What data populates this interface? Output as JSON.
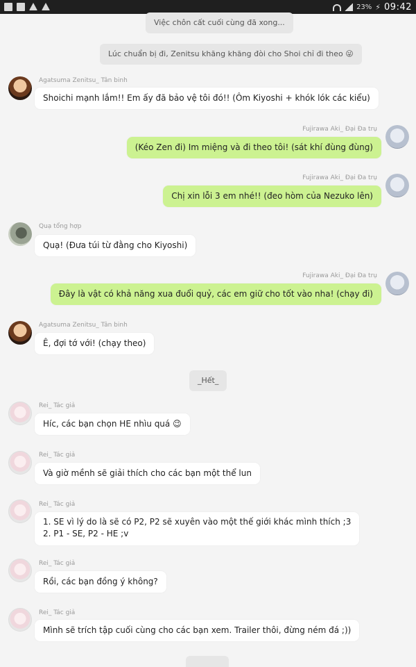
{
  "status_bar": {
    "battery_percent": "23%",
    "time": "09:42"
  },
  "system_messages": [
    "Việc chôn cất cuối cùng đã xong...",
    "Lúc chuẩn bị đi, Zenitsu khăng khăng đòi cho Shoi chỉ đi theo 😜",
    "_Hết_"
  ],
  "messages": [
    {
      "sender": "Agatsuma Zenitsu_ Tân binh",
      "side": "left",
      "avatar": "zenitsu-avatar",
      "lines": [
        "Shoichi mạnh lắm!! Em ấy đã bảo vệ tôi đó!! (Ôm Kiyoshi + khók lók các kiểu)"
      ]
    },
    {
      "sender": "Fujirawa Aki_ Đại Đa trụ",
      "side": "right",
      "avatar": "aki-avatar",
      "lines": [
        "(Kéo Zen đi) Im miệng và đi theo tôi! (sát khí đùng đùng)"
      ]
    },
    {
      "sender": "Fujirawa Aki_ Đại Đa trụ",
      "side": "right",
      "avatar": "aki-avatar",
      "lines": [
        "Chị xin lỗi 3 em nhé!! (đeo hòm của Nezuko lên)"
      ]
    },
    {
      "sender": "Quạ tổng hợp",
      "side": "left",
      "avatar": "crow-avatar",
      "lines": [
        "Quạ! (Đưa túi từ đằng cho Kiyoshi)"
      ]
    },
    {
      "sender": "Fujirawa Aki_ Đại Đa trụ",
      "side": "right",
      "avatar": "aki-avatar",
      "lines": [
        "Đây là vật có khả năng xua đuổi quỷ, các em giữ cho tốt vào nha! (chạy đi)"
      ]
    },
    {
      "sender": "Agatsuma Zenitsu_ Tân binh",
      "side": "left",
      "avatar": "zenitsu-avatar",
      "lines": [
        "Ê, đợi tớ với! (chạy theo)"
      ]
    },
    {
      "sender": "Rei_ Tác giả",
      "side": "left",
      "avatar": "rei-avatar",
      "lines": [
        "Híc, các bạn chọn HE nhìu quá 😉"
      ]
    },
    {
      "sender": "Rei_ Tác giả",
      "side": "left",
      "avatar": "rei-avatar",
      "lines": [
        "Và giờ mềnh sẽ giải thích cho các bạn một thể lun"
      ]
    },
    {
      "sender": "Rei_ Tác giả",
      "side": "left",
      "avatar": "rei-avatar",
      "lines": [
        "1. SE vì lý do là sẽ có P2, P2 sẽ xuyên vào một thế giới khác mình thích ;3",
        "2. P1 - SE, P2 - HE ;v"
      ]
    },
    {
      "sender": "Rei_ Tác giả",
      "side": "left",
      "avatar": "rei-avatar",
      "lines": [
        "Rồi, các bạn đồng ý không?"
      ]
    },
    {
      "sender": "Rei_ Tác giả",
      "side": "left",
      "avatar": "rei-avatar",
      "lines": [
        "Mình sẽ trích tập cuối cùng cho các bạn xem. Trailer thôi, đừng ném đá ;))"
      ]
    }
  ],
  "colors": {
    "background": "#f4f4f4",
    "bubble_left": "#ffffff",
    "bubble_right": "#ccf291",
    "system_bubble": "#e6e6e6",
    "status_bar": "#1f1f1f"
  }
}
